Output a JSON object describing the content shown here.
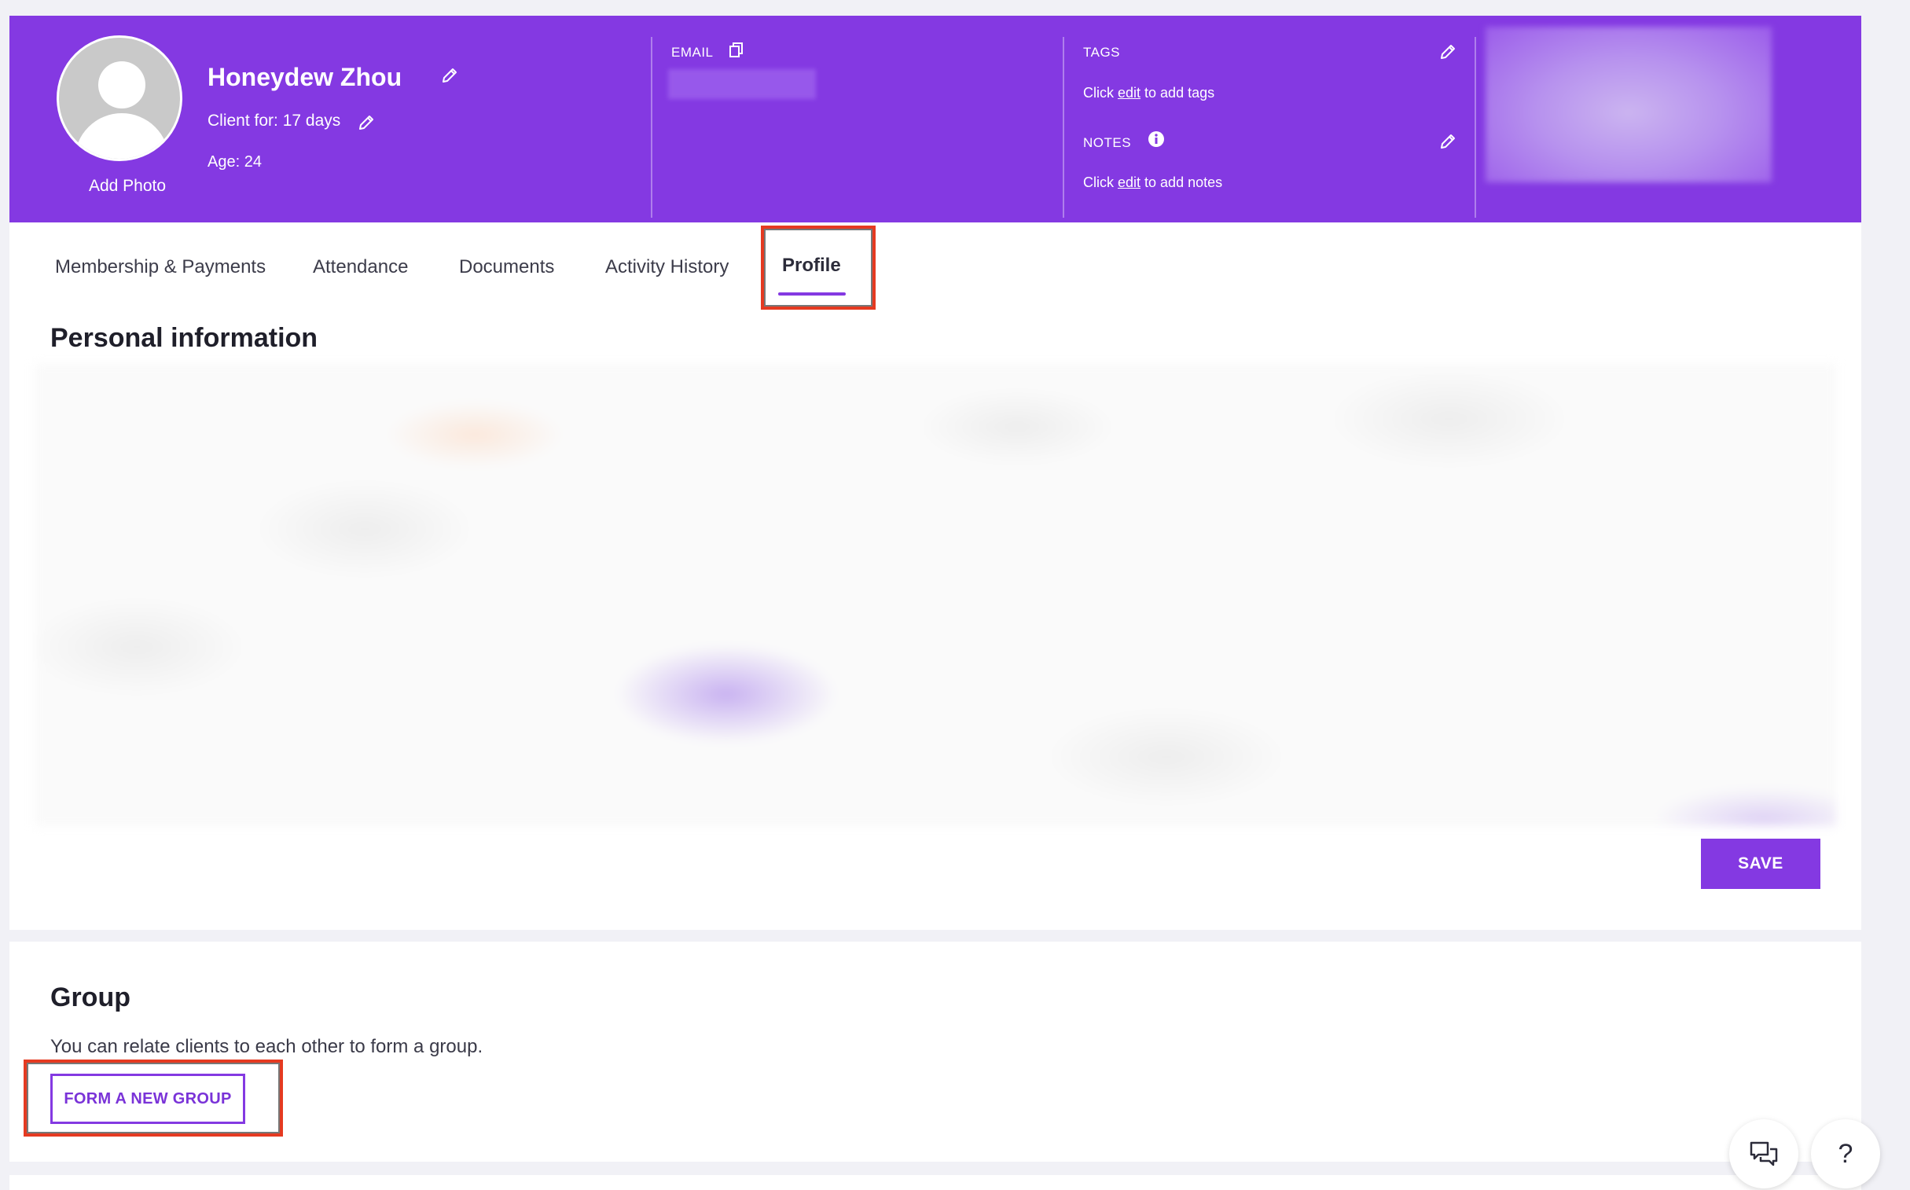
{
  "header": {
    "add_photo": "Add Photo",
    "client_name": "Honeydew Zhou",
    "client_for": "Client for: 17 days",
    "age": "Age: 24",
    "email_label": "EMAIL",
    "tags_label": "TAGS",
    "tags_hint_pre": "Click ",
    "tags_hint_link": "edit",
    "tags_hint_post": " to add tags",
    "notes_label": "NOTES",
    "notes_hint_pre": "Click ",
    "notes_hint_link": "edit",
    "notes_hint_post": " to add notes"
  },
  "tabs": [
    {
      "label": "Membership & Payments"
    },
    {
      "label": "Attendance"
    },
    {
      "label": "Documents"
    },
    {
      "label": "Activity History"
    },
    {
      "label": "Profile",
      "active": true
    }
  ],
  "personal": {
    "title": "Personal information",
    "save_label": "SAVE"
  },
  "group": {
    "title": "Group",
    "description": "You can relate clients to each other to form a group.",
    "button_label": "FORM A NEW GROUP"
  },
  "floating": {
    "help_label": "?"
  },
  "colors": {
    "brand": "#8439e2",
    "highlight": "#e53a21"
  }
}
